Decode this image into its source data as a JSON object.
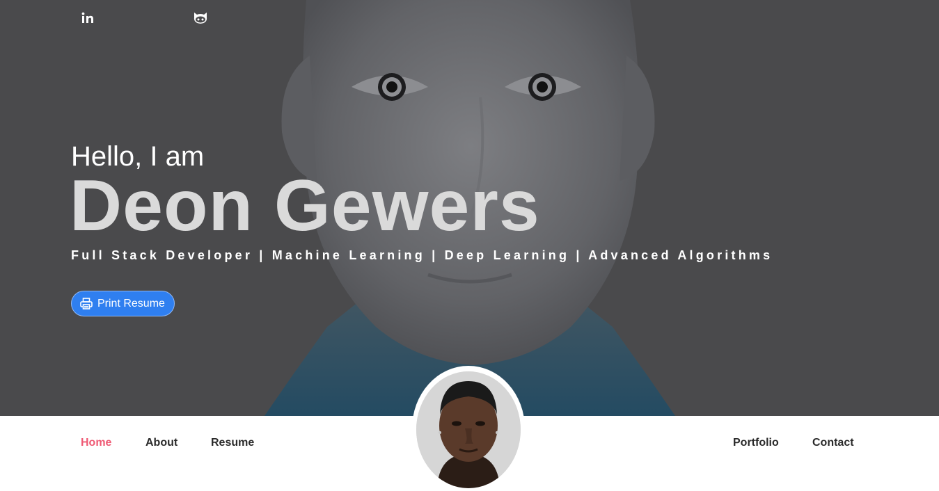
{
  "social": {
    "linkedin_icon": "linkedin-icon",
    "github_icon": "github-icon"
  },
  "hero": {
    "greeting": "Hello, I am",
    "name": "Deon Gewers",
    "tagline": "Full Stack Developer | Machine Learning | Deep Learning | Advanced Algorithms",
    "print_button": {
      "label": "Print Resume",
      "icon": "printer-icon",
      "color": "#2f7ff0"
    }
  },
  "nav": {
    "left": [
      {
        "label": "Home",
        "active": true
      },
      {
        "label": "About",
        "active": false
      },
      {
        "label": "Resume",
        "active": false
      }
    ],
    "right": [
      {
        "label": "Portfolio",
        "active": false
      },
      {
        "label": "Contact",
        "active": false
      }
    ],
    "active_color": "#ef5a74"
  },
  "colors": {
    "hero_overlay": "#4a4a4c",
    "nav_background": "#ffffff"
  }
}
